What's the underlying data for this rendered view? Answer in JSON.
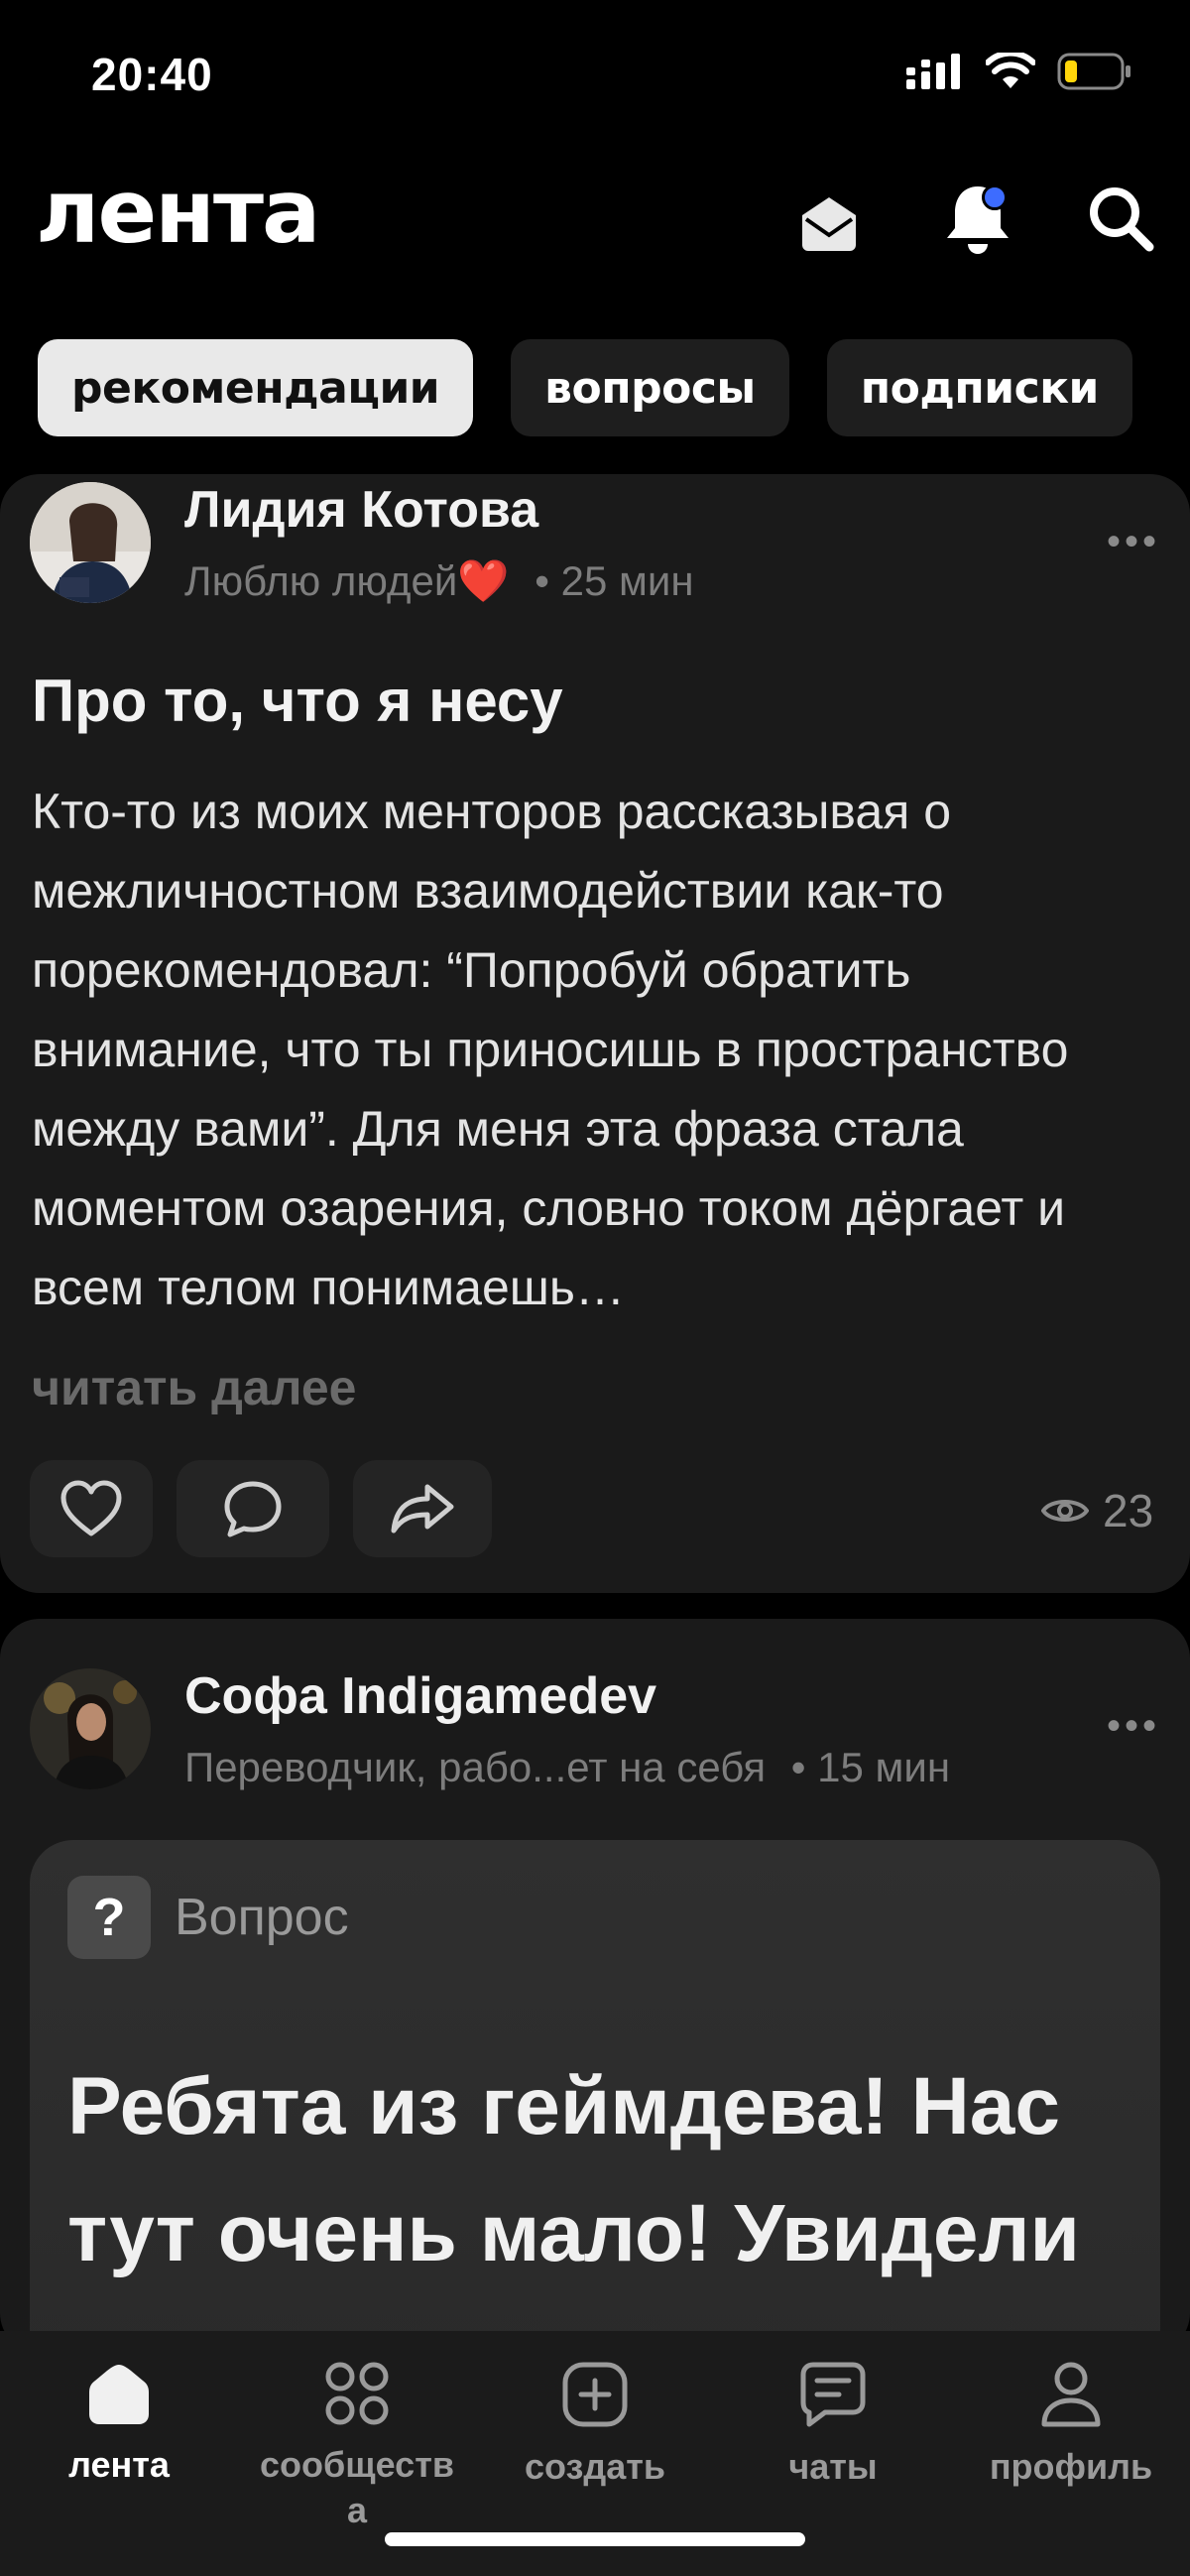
{
  "status_bar": {
    "time": "20:40"
  },
  "header": {
    "title": "лента"
  },
  "tabs": [
    {
      "label": "рекомендации",
      "active": true
    },
    {
      "label": "вопросы",
      "active": false
    },
    {
      "label": "подписки",
      "active": false
    }
  ],
  "posts": [
    {
      "author": "Лидия Котова",
      "bio": "Люблю людей❤️",
      "time": "• 25 мин",
      "title": "Про то, что я несу",
      "body": "Кто-то из моих менторов рассказывая о межличностном взаимодействии как-то порекомендовал: “Попробуй обратить внимание, что ты приносишь в пространство между вами”. Для меня эта фраза стала моментом озарения, словно током дёргает и всем телом понимаешь…",
      "read_more": "читать далее",
      "views": "23"
    },
    {
      "author": "Софа Indigamedev",
      "bio": "Переводчик, рабо...ет на себя",
      "time": "• 15 мин",
      "question_label": "Вопрос",
      "question_text": "Ребята из геймдева! Нас тут очень мало! Увидели"
    }
  ],
  "bottom_nav": [
    {
      "label": "лента",
      "icon": "home-icon",
      "active": true
    },
    {
      "label": "сообществ\nа",
      "icon": "grid-icon",
      "active": false
    },
    {
      "label": "создать",
      "icon": "plus-square-icon",
      "active": false
    },
    {
      "label": "чаты",
      "icon": "chat-icon",
      "active": false
    },
    {
      "label": "профиль",
      "icon": "user-icon",
      "active": false
    }
  ],
  "colors": {
    "background": "#000000",
    "card": "#1a1a1a",
    "accent_dot": "#3d6cff"
  }
}
